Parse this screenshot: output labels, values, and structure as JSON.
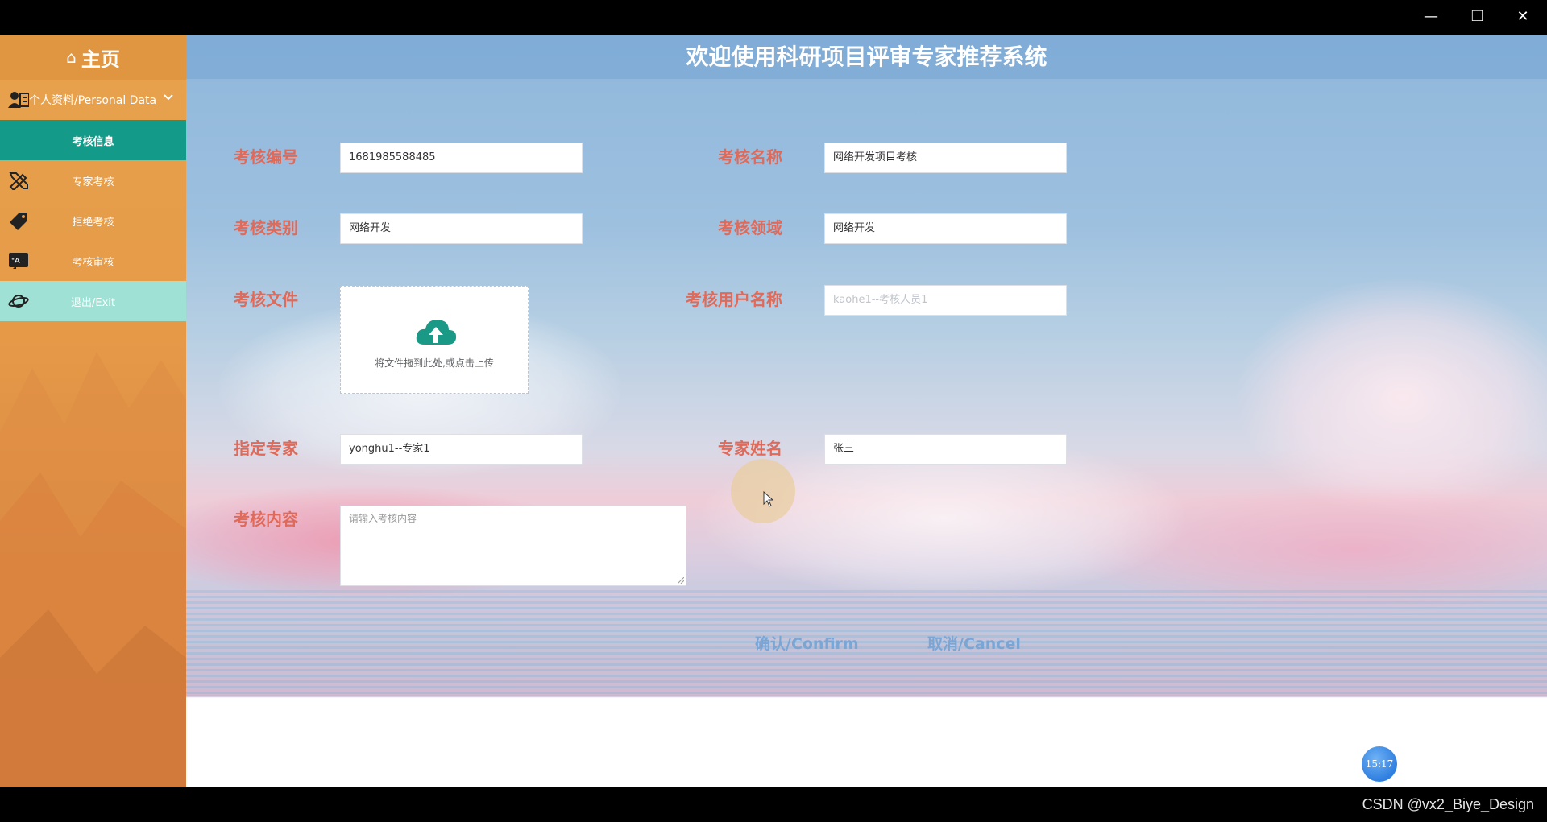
{
  "window": {
    "minimize": "—",
    "restore": "❐",
    "close": "✕"
  },
  "sidebar": {
    "home_label": "主页",
    "personal_label": "个人资料/Personal Data",
    "items": [
      {
        "label": "考核信息",
        "icon": "document-icon",
        "active": true
      },
      {
        "label": "专家考核",
        "icon": "pencil-ruler-icon"
      },
      {
        "label": "拒绝考核",
        "icon": "tag-icon"
      },
      {
        "label": "考核审核",
        "icon": "translate-icon"
      },
      {
        "label": "退出/Exit",
        "icon": "planet-icon"
      }
    ]
  },
  "header": {
    "title": "欢迎使用科研项目评审专家推荐系统"
  },
  "form": {
    "code_label": "考核编号",
    "code_value": "1681985588485",
    "name_label": "考核名称",
    "name_value": "网络开发项目考核",
    "type_label": "考核类别",
    "type_value": "网络开发",
    "field_label": "考核领域",
    "field_value": "网络开发",
    "file_label": "考核文件",
    "upload_text": "将文件拖到此处,或点击上传",
    "user_label": "考核用户名称",
    "user_placeholder": "kaohe1--考核人员1",
    "expert_label": "指定专家",
    "expert_value": "yonghu1--专家1",
    "expert_name_label": "专家姓名",
    "expert_name_value": "张三",
    "content_label": "考核内容",
    "content_placeholder": "请输入考核内容",
    "confirm_label": "确认/Confirm",
    "cancel_label": "取消/Cancel"
  },
  "clock": "15:17",
  "watermark": "CSDN @vx2_Biye_Design",
  "colors": {
    "sidebar": "#e69a48",
    "active_item": "#139a88",
    "exit_item": "#9fe1d4",
    "label": "#e06a5a",
    "button_text": "#7aa6d6"
  }
}
